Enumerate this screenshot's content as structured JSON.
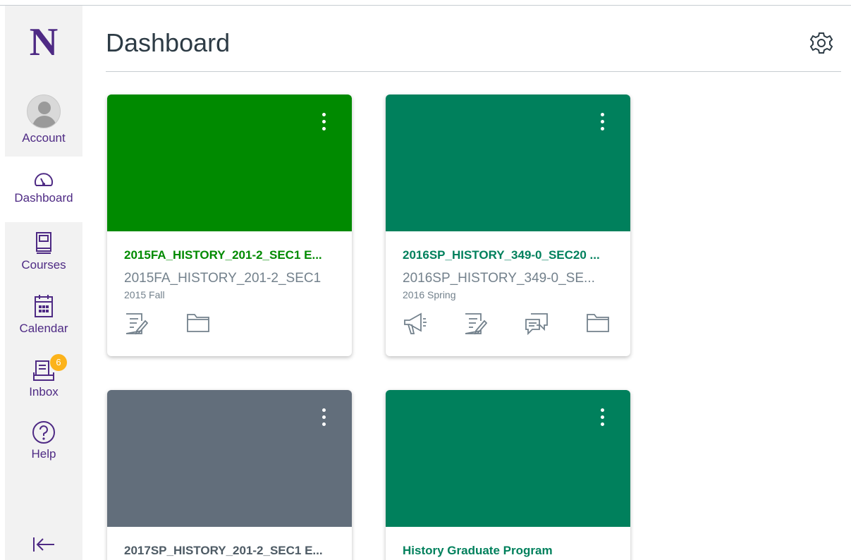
{
  "app": {
    "logo_letter": "N"
  },
  "nav": {
    "account": "Account",
    "dashboard": "Dashboard",
    "courses": "Courses",
    "calendar": "Calendar",
    "inbox": "Inbox",
    "inbox_badge": "6",
    "help": "Help"
  },
  "header": {
    "title": "Dashboard"
  },
  "colors": {
    "brand": "#4e2a84",
    "green": "#008a00",
    "teal": "#00805c",
    "slate": "#626e7b",
    "badge": "#fcb31b"
  },
  "cards": [
    {
      "title": "2015FA_HISTORY_201-2_SEC1 E...",
      "subtitle": "2015FA_HISTORY_201-2_SEC1",
      "term": "2015 Fall",
      "color": "#008a00",
      "title_color": "#008a00",
      "actions": [
        "assignments-icon",
        "files-icon"
      ]
    },
    {
      "title": "2016SP_HISTORY_349-0_SEC20 ...",
      "subtitle": "2016SP_HISTORY_349-0_SE...",
      "term": "2016 Spring",
      "color": "#00805c",
      "title_color": "#00805c",
      "actions": [
        "announcements-icon",
        "assignments-icon",
        "discussions-icon",
        "files-icon"
      ]
    },
    {
      "title": "2017SP_HISTORY_201-2_SEC1 E...",
      "subtitle": "",
      "term": "",
      "color": "#626e7b",
      "title_color": "#4d5a64",
      "actions": []
    },
    {
      "title": "History Graduate Program",
      "subtitle": "",
      "term": "",
      "color": "#00805c",
      "title_color": "#00805c",
      "actions": []
    }
  ]
}
